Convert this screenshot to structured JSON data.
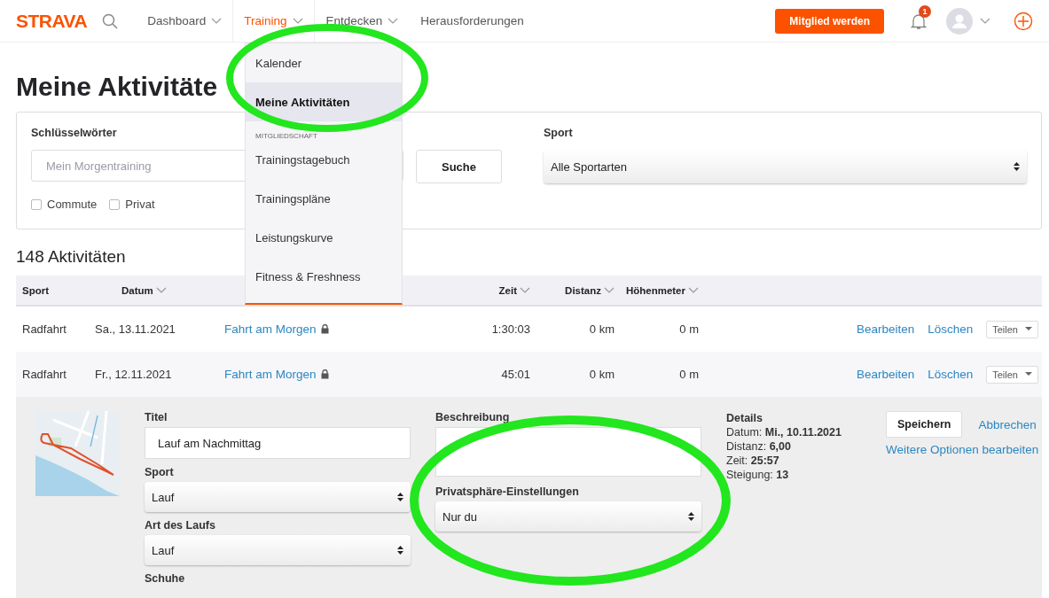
{
  "nav": {
    "logo": "STRAVA",
    "items": [
      {
        "label": "Dashboard",
        "selected": false,
        "caret": true
      },
      {
        "label": "Training",
        "selected": true,
        "caret": true
      },
      {
        "label": "Entdecken",
        "selected": false,
        "caret": true
      },
      {
        "label": "Herausforderungen",
        "selected": false,
        "caret": false
      }
    ],
    "cta": "Mitglied werden",
    "notification_count": "1"
  },
  "menu": {
    "items": [
      {
        "kind": "link",
        "label": "Kalender",
        "selected": false
      },
      {
        "kind": "link",
        "label": "Meine Aktivitäten",
        "selected": true
      },
      {
        "kind": "section",
        "label": "MITGLIEDSCHAFT"
      },
      {
        "kind": "link",
        "label": "Trainingstagebuch",
        "selected": false
      },
      {
        "kind": "link",
        "label": "Trainingspläne",
        "selected": false
      },
      {
        "kind": "link",
        "label": "Leistungskurve",
        "selected": false
      },
      {
        "kind": "link",
        "label": "Fitness & Freshness",
        "selected": false
      }
    ]
  },
  "page_title": "Meine Aktivitäte",
  "filters": {
    "keywords_label": "Schlüsselwörter",
    "keywords_placeholder": "Mein Morgentraining",
    "search_button": "Suche",
    "sport_label": "Sport",
    "sport_value": "Alle Sportarten",
    "checkboxes": [
      {
        "label": "Commute",
        "checked": false
      },
      {
        "label": "Privat",
        "checked": false
      }
    ]
  },
  "count": "148 Aktivitäten",
  "table": {
    "columns": [
      {
        "label": "Sport",
        "sortable": false
      },
      {
        "label": "Datum",
        "sortable": true
      },
      {
        "label": "Zeit",
        "sortable": true
      },
      {
        "label": "Distanz",
        "sortable": true
      },
      {
        "label": "Höhenmeter",
        "sortable": true
      }
    ],
    "rows": [
      {
        "sport": "Radfahrt",
        "date": "Sa., 13.11.2021",
        "title": "Fahrt am Morgen",
        "private": true,
        "time": "1:30:03",
        "distance": "0 km",
        "elevation": "0 m",
        "edit": "Bearbeiten",
        "delete": "Löschen",
        "share": "Teilen"
      },
      {
        "sport": "Radfahrt",
        "date": "Fr., 12.11.2021",
        "title": "Fahrt am Morgen",
        "private": true,
        "time": "45:01",
        "distance": "0 km",
        "elevation": "0 m",
        "edit": "Bearbeiten",
        "delete": "Löschen",
        "share": "Teilen"
      }
    ]
  },
  "edit_panel": {
    "title_label": "Titel",
    "title_value": "Lauf am Nachmittag",
    "sport_label": "Sport",
    "sport_value": "Lauf",
    "run_type_label": "Art des Laufs",
    "run_type_value": "Lauf",
    "shoes_label": "Schuhe",
    "description_label": "Beschreibung",
    "privacy_label": "Privatsphäre-Einstellungen",
    "privacy_value": "Nur du",
    "details_label": "Details",
    "details": [
      "Datum: **Mi., 10.11.2021**",
      "Distanz: **6,00**",
      "Zeit: **25:57**",
      "Steigung: **13**"
    ],
    "save": "Speichern",
    "cancel": "Abbrechen",
    "more_options": "Weitere Optionen bearbeiten"
  }
}
